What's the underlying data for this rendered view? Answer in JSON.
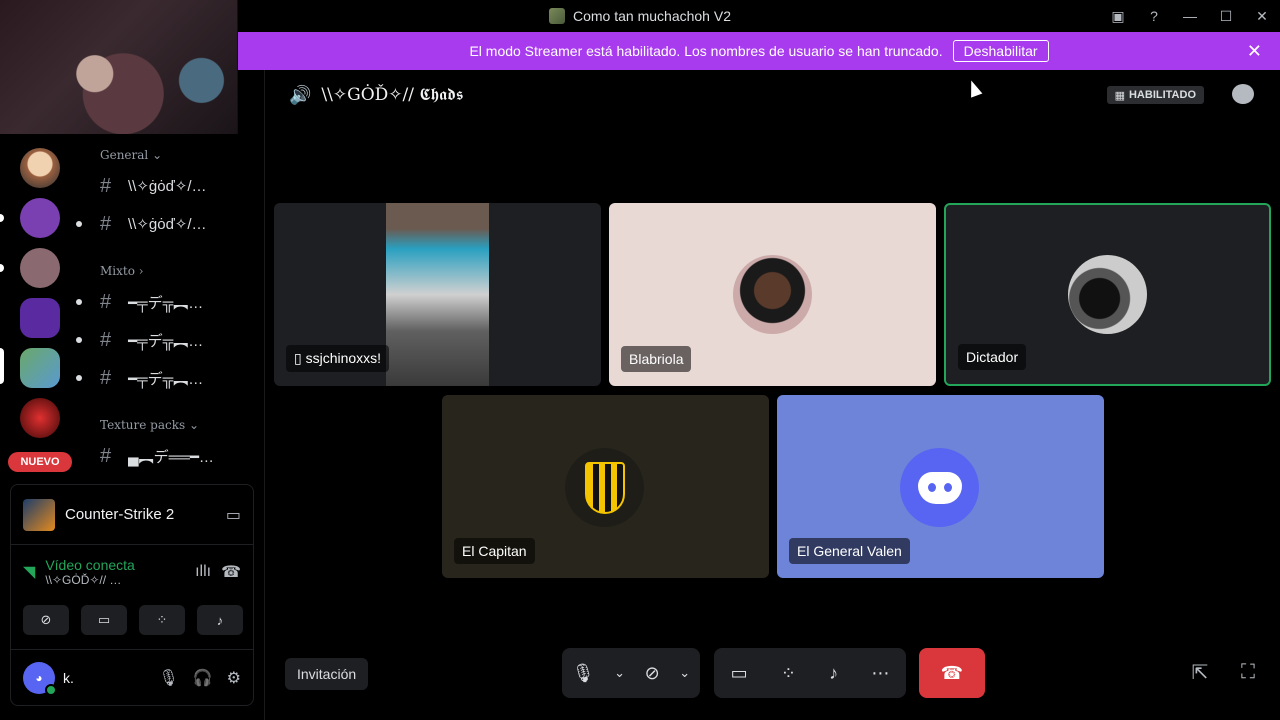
{
  "titlebar": {
    "title": "Como tan muchachoh V2"
  },
  "banner": {
    "text": "El modo Streamer está habilitado. Los nombres de usuario se han truncado.",
    "button": "Deshabilitar"
  },
  "sidebar": {
    "badge": "NUEVO",
    "categories": [
      "General",
      "Mixto",
      "Texture packs"
    ],
    "channels": [
      "\\\\✧ġȯď✧/…",
      "\\\\✧ġȯď✧/…",
      "━╤デ╦︻…",
      "━╤デ╦︻…",
      "━╤デ╦︻…",
      "▄︻デ══━…"
    ]
  },
  "activity": {
    "name": "Counter-Strike 2"
  },
  "voice": {
    "status": "Vídeo conecta",
    "channel": "\\\\✧GȮĎ✧// …"
  },
  "user": {
    "name": "k."
  },
  "call": {
    "channel_name": "\\\\✧GȮĎ✧// 𝕮𝖍𝖆𝖉𝖘",
    "live_badge": "HABILITADO",
    "participants": [
      {
        "name": "ssjchinoxxs!"
      },
      {
        "name": "Blabriola"
      },
      {
        "name": "Dictador"
      },
      {
        "name": "El Capitan"
      },
      {
        "name": "El General Valen"
      }
    ],
    "invite": "Invitación"
  },
  "colors": {
    "banner": "#a93bef",
    "discord_blurple": "#5865f2",
    "end_call": "#da373c",
    "speaking_border": "#23a55a"
  }
}
